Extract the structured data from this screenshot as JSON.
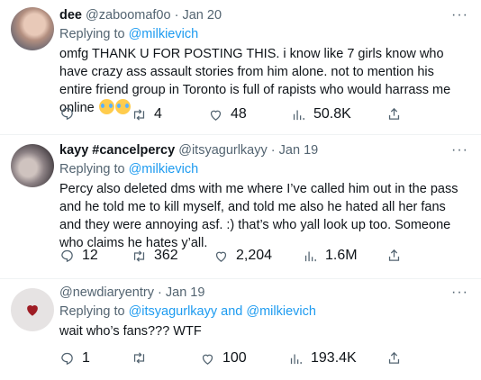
{
  "tweets": [
    {
      "name": "dee",
      "handle": "@zaboomaf0o",
      "dot": "·",
      "date": "Jan 20",
      "replying_label": "Replying to",
      "replying_to": [
        "@milkievich"
      ],
      "replying_join": "",
      "text": "omfg THANK U FOR POSTING THIS.  i know like 7 girls know who have crazy ass assault stories from him alone. not to mention his entire friend group in Toronto is full of rapists who would harrass me online",
      "emoji": "loudly-crying-face",
      "stats": {
        "replies": "",
        "retweets": "4",
        "likes": "48",
        "views": "50.8K"
      }
    },
    {
      "name": "kayy #cancelpercy",
      "handle": "@itsyagurlkayy",
      "dot": "·",
      "date": "Jan 19",
      "replying_label": "Replying to",
      "replying_to": [
        "@milkievich"
      ],
      "replying_join": "",
      "text": "Percy also deleted dms with me where I’ve called him out in the pass and he told me to kill myself, and told me also he hated all her fans and they were annoying asf. :) that’s who yall look up too. Someone who claims he hates y’all.",
      "stats": {
        "replies": "12",
        "retweets": "362",
        "likes": "2,204",
        "views": "1.6M"
      }
    },
    {
      "name": "",
      "handle": "@newdiaryentry",
      "dot": "·",
      "date": "Jan 19",
      "replying_label": "Replying to",
      "replying_to": [
        "@itsyagurlkayy",
        "@milkievich"
      ],
      "replying_join": "and",
      "text": "wait who’s fans??? WTF",
      "stats": {
        "replies": "1",
        "retweets": "",
        "likes": "100",
        "views": "193.4K"
      }
    }
  ],
  "icons": [
    "reply-icon",
    "retweet-icon",
    "like-icon",
    "views-icon",
    "share-icon",
    "more-icon"
  ],
  "colors": {
    "text": "#0f1419",
    "secondary": "#536471",
    "link": "#1d9bf0",
    "divider": "#eff3f4"
  }
}
